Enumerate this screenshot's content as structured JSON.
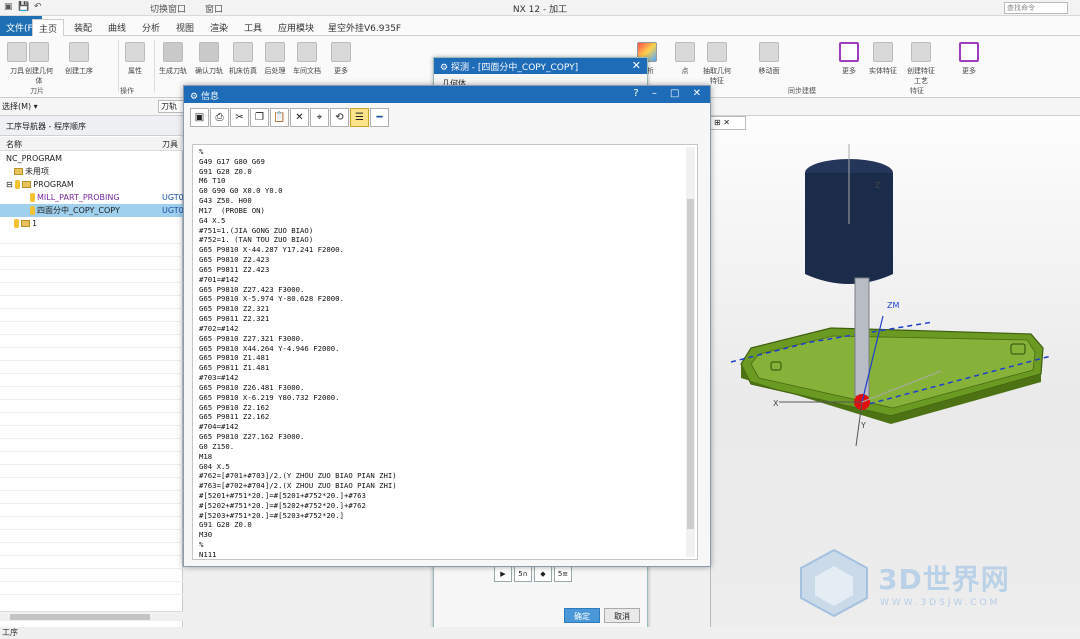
{
  "window": {
    "title": "NX 12 - 加工",
    "quick_access": [
      "保存",
      "撤消",
      "切换窗口",
      "窗口"
    ],
    "search_placeholder": "查找命令"
  },
  "menu_tabs": [
    "文件(F)",
    "主页",
    "装配",
    "曲线",
    "分析",
    "视图",
    "渲染",
    "工具",
    "应用模块",
    "星空外挂V6.935F"
  ],
  "ribbon": {
    "buttons": [
      "刀具",
      "创建几何体",
      "创建工序",
      "属性",
      "生成刀轨",
      "确认刀轨",
      "机床仿真",
      "后处理",
      "车间文档",
      "更多",
      "分析",
      "点",
      "抽取几何特征",
      "移动面",
      "更多",
      "实体特征",
      "创建特征工艺",
      "更多"
    ],
    "groups": [
      "刀片",
      "操作",
      "同步建模",
      "特征"
    ]
  },
  "toolbar2": {
    "filter_label": "选择(M) ▾",
    "cutter_value": "刀轨"
  },
  "navigator": {
    "title": "工序导航器 - 程序顺序",
    "columns": [
      "名称",
      "刀具"
    ],
    "rows": [
      {
        "name": "NC_PROGRAM",
        "tool": ""
      },
      {
        "name": "未用项",
        "tool": ""
      },
      {
        "name": "PROGRAM",
        "tool": ""
      },
      {
        "name": "MILL_PART_PROBING",
        "tool": "UGT0"
      },
      {
        "name": "四面分中_COPY_COPY",
        "tool": "UGT0"
      },
      {
        "name": "1",
        "tool": ""
      }
    ]
  },
  "status_bar": "工序",
  "probe_dialog": {
    "title": "探测 - [四面分中_COPY_COPY]",
    "section": "几何体",
    "ok_label": "确定",
    "cancel_label": "取消"
  },
  "info_dialog": {
    "title": "信息",
    "window_controls": "? – □ ✕",
    "toolbar_icons": [
      "save-icon",
      "print-icon",
      "cut-icon",
      "copy-icon",
      "paste-icon",
      "delete-icon",
      "find-icon",
      "rotate-icon",
      "highlight-icon",
      "minus-icon"
    ],
    "text": "%\nG49 G17 G80 G69\nG91 G28 Z0.0\nM6 T10\nG0 G90 G0 X0.0 Y0.0\nG43 Z50. H00\nM17  (PROBE ON)\nG4 X.5\n#751=1.(JIA GONG ZUO BIAO)\n#752=1. (TAN TOU ZUO BIAO)\nG65 P9810 X-44.287 Y17.241 F2000.\nG65 P9810 Z2.423\nG65 P9811 Z2.423\n#701=#142\nG65 P9810 Z27.423 F3000.\nG65 P9810 X-5.974 Y-80.628 F2000.\nG65 P9810 Z2.321\nG65 P9811 Z2.321\n#702=#142\nG65 P9810 Z27.321 F3000.\nG65 P9810 X44.264 Y-4.946 F2000.\nG65 P9810 Z1.481\nG65 P9811 Z1.481\n#703=#142\nG65 P9810 Z26.481 F3000.\nG65 P9810 X-6.219 Y80.732 F2000.\nG65 P9810 Z2.162\nG65 P9811 Z2.162\n#704=#142\nG65 P9810 Z27.162 F3000.\nG0 Z150.\nM18\nG04 X.5\n#762=[#701+#703]/2.(Y ZHOU ZUO BIAO PIAN ZHI)\n#763=[#702+#704]/2.(X ZHOU ZUO BIAO PIAN ZHI)\n#[5201+#751*20.]=#[5201+#752*20.]+#763\n#[5202+#751*20.]=#[5202+#752*20.]+#762\n#[5203+#751*20.]=#[5203+#752*20.]\nG91 G28 Z0.0\nM30\n%\nN111"
  },
  "viewport": {
    "axis_labels": [
      "ZM",
      "Z",
      "Y",
      "X"
    ]
  },
  "watermark": {
    "text": "3D世界网",
    "sub": "WWW.3DSJW.COM"
  },
  "colors": {
    "title_blue": "#1e6bb8",
    "file_tab": "#1f6fb5",
    "part_green": "#5a8a1a",
    "tool_navy": "#1b2b4a"
  }
}
